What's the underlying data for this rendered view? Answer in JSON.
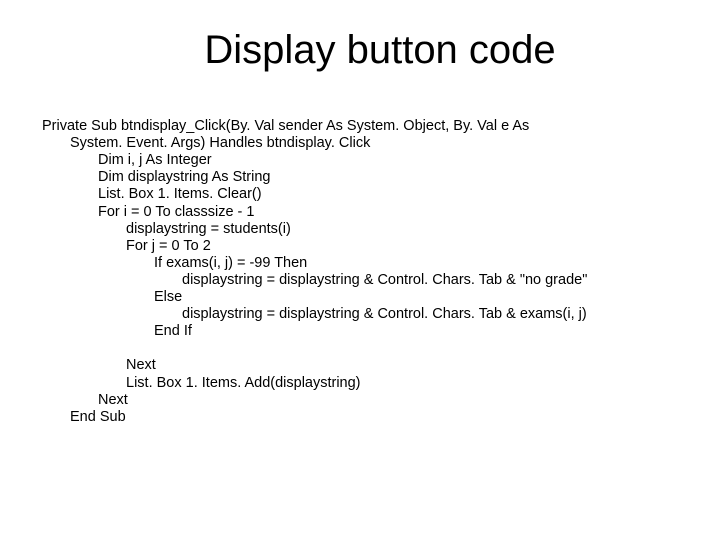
{
  "title": "Display button code",
  "code": {
    "l1": "Private Sub btndisplay_Click(By. Val sender As System. Object, By. Val e As",
    "l1b": "System. Event. Args) Handles btndisplay. Click",
    "l2": "Dim i, j As Integer",
    "l3": "Dim displaystring As String",
    "l4": "List. Box 1. Items. Clear()",
    "l5": "For i = 0 To classsize - 1",
    "l6": "displaystring = students(i)",
    "l7": "For j = 0 To 2",
    "l8": "If exams(i, j) = -99 Then",
    "l9": "displaystring = displaystring & Control. Chars. Tab & \"no grade\"",
    "l10": "Else",
    "l11": "displaystring = displaystring & Control. Chars. Tab & exams(i, j)",
    "l12": "End If",
    "l13": "Next",
    "l14": "List. Box 1. Items. Add(displaystring)",
    "l15": "Next",
    "l16": "End Sub"
  }
}
